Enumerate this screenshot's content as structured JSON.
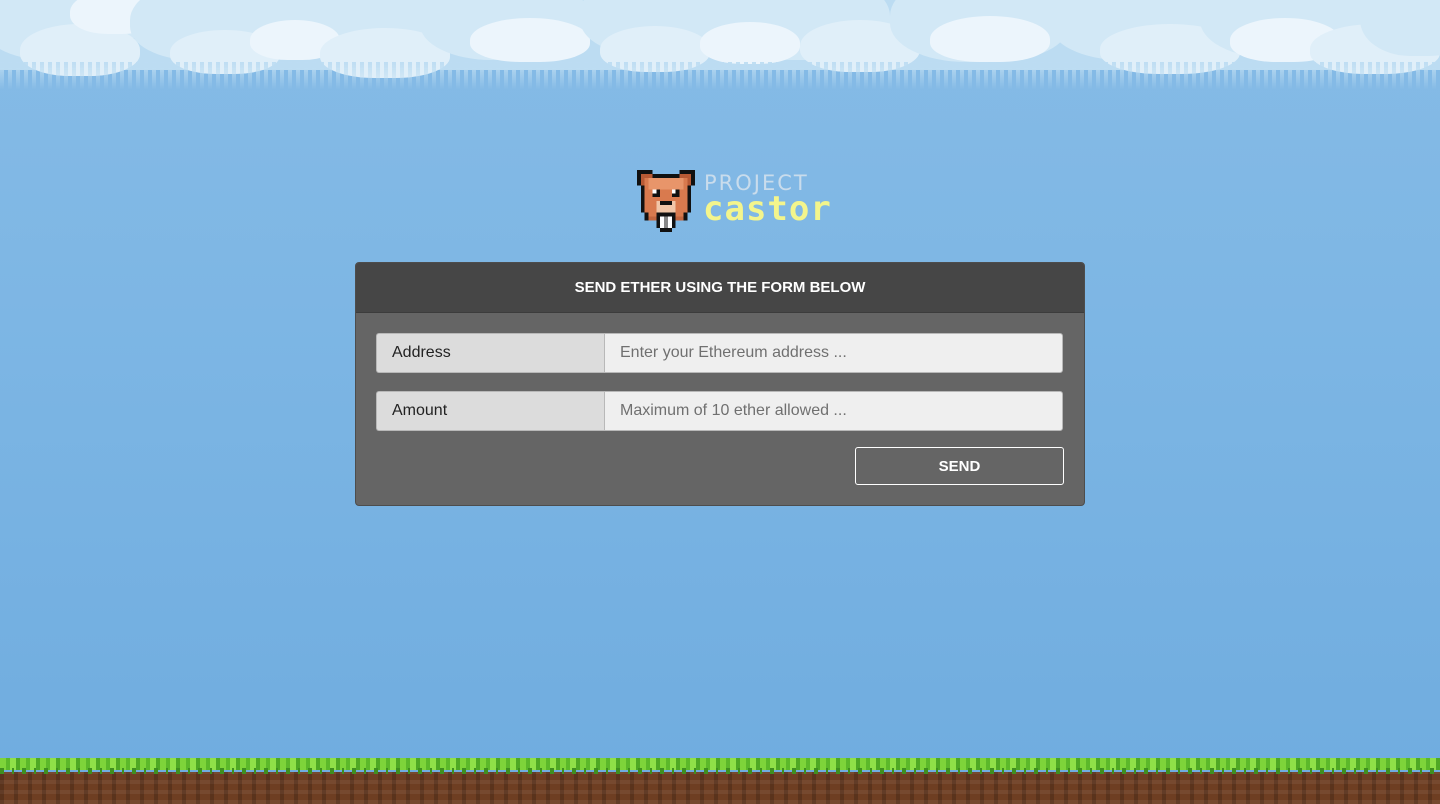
{
  "logo": {
    "line1": "PROJECT",
    "line2": "castor",
    "mascot_icon": "beaver-icon"
  },
  "form": {
    "title": "SEND ETHER USING THE FORM BELOW",
    "address_label": "Address",
    "address_placeholder": "Enter your Ethereum address ...",
    "amount_label": "Amount",
    "amount_placeholder": "Maximum of 10 ether allowed ...",
    "send_label": "SEND"
  },
  "colors": {
    "sky": "#7db6e4",
    "panel": "#656565",
    "panel_header": "#464646",
    "logo_accent": "#f3f58c",
    "grass": "#6cc433",
    "dirt": "#6e3e22"
  }
}
